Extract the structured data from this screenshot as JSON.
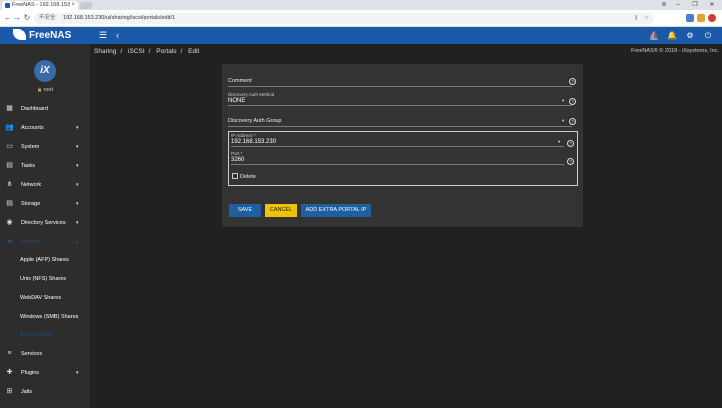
{
  "browser": {
    "tab_title": "FreeNAS - 192.168.153",
    "url_prefix": "不安全",
    "url": "192.168.153.230/ui/sharing/iscsi/portals/edit/1",
    "window_controls": [
      "⊖",
      "–",
      "❐",
      "✕"
    ],
    "tab_close": "×"
  },
  "header": {
    "logo": "FreeNAS",
    "menu_icon": "☰",
    "back_icon": "‹",
    "actions": [
      "⛵",
      "🔔",
      "⚙",
      "⏻"
    ]
  },
  "user": {
    "avatar_text": "iX",
    "name": "root",
    "lock": "🔒"
  },
  "sidebar": {
    "items": [
      {
        "label": "Dashboard",
        "icon": "▦",
        "caret": ""
      },
      {
        "label": "Accounts",
        "icon": "👥",
        "caret": "▾"
      },
      {
        "label": "System",
        "icon": "▭",
        "caret": "▾"
      },
      {
        "label": "Tasks",
        "icon": "▤",
        "caret": "▾"
      },
      {
        "label": "Network",
        "icon": "⋔",
        "caret": "▾"
      },
      {
        "label": "Storage",
        "icon": "▤",
        "caret": "▾"
      },
      {
        "label": "Directory Services",
        "icon": "◉",
        "caret": "▾"
      },
      {
        "label": "Sharing",
        "icon": "▰",
        "caret": "▴"
      },
      {
        "label": "Apple (AFP) Shares",
        "icon": "",
        "caret": ""
      },
      {
        "label": "Unix (NFS) Shares",
        "icon": "",
        "caret": ""
      },
      {
        "label": "WebDAV Shares",
        "icon": "",
        "caret": ""
      },
      {
        "label": "Windows (SMB) Shares",
        "icon": "",
        "caret": ""
      },
      {
        "label": "Block (iSCSI)",
        "icon": "",
        "caret": ""
      },
      {
        "label": "Services",
        "icon": "≡",
        "caret": ""
      },
      {
        "label": "Plugins",
        "icon": "✚",
        "caret": "▾"
      },
      {
        "label": "Jails",
        "icon": "⊞",
        "caret": ""
      }
    ]
  },
  "breadcrumb": [
    "Sharing",
    "/",
    "iSCSI",
    "/",
    "Portals",
    "/",
    "Edit"
  ],
  "copyright": "FreeNAS® © 2018 - iXsystems, Inc.",
  "form": {
    "comment_label": "Comment",
    "comment_value": "",
    "auth_method_label": "Discovery Auth Method",
    "auth_method_value": "NONE",
    "auth_group_label": "Discovery Auth Group",
    "auth_group_value": "",
    "ip_label": "IP Address *",
    "ip_value": "192.168.153.230",
    "port_label": "Port *",
    "port_value": "3260",
    "delete_label": "Delete",
    "help_glyph": "?",
    "dropdown_glyph": "▾"
  },
  "buttons": {
    "save": "Save",
    "cancel": "Cancel",
    "add_ip": "Add extra Portal IP"
  },
  "colors": {
    "header_blue": "#1a5aa8",
    "cancel_yellow": "#f0c20a",
    "button_blue": "#1f5fa0",
    "active_nav": "#1f4f87"
  }
}
